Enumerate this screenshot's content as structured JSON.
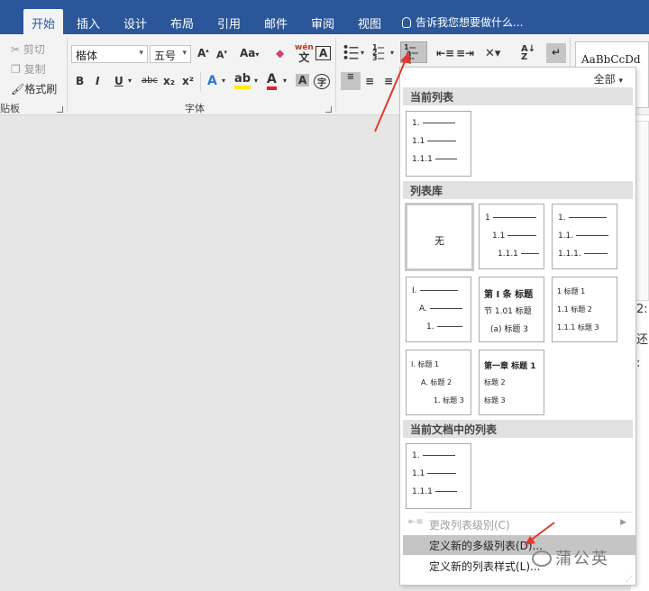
{
  "tabs": [
    "开始",
    "插入",
    "设计",
    "布局",
    "引用",
    "邮件",
    "审阅",
    "视图"
  ],
  "tell_me": "告诉我您想要做什么...",
  "clipboard": {
    "cut": "剪切",
    "copy": "复制",
    "format_painter": "格式刷",
    "group_label": "贴板"
  },
  "font": {
    "family": "楷体",
    "size": "五号",
    "group_label": "字体",
    "change_case": "Aa",
    "phonetic": "wén",
    "phonetic_char": "文",
    "bold": "B",
    "italic": "I",
    "underline": "U",
    "strikethrough": "abc",
    "subscript": "x₂",
    "superscript": "x²"
  },
  "styles_preview": "AaBbCcDd",
  "dropdown": {
    "filter": "全部",
    "current_list_header": "当前列表",
    "library_header": "列表库",
    "doc_lists_header": "当前文档中的列表",
    "none_label": "无",
    "cards": {
      "current": [
        "1.",
        "1.1",
        "1.1.1"
      ],
      "lib2": [
        "1",
        "1.1",
        "1.1.1"
      ],
      "lib3": [
        "1.",
        "1.1.",
        "1.1.1."
      ],
      "lib4": [
        "I.",
        "A.",
        "1."
      ],
      "lib5": [
        "第 I 条 标题",
        "节 1.01 标题",
        "(a) 标题 3"
      ],
      "lib6": [
        "1 标题 1",
        "1.1 标题 2",
        "1.1.1 标题 3"
      ],
      "lib7": [
        "I. 标题 1",
        "A. 标题 2",
        "1. 标题 3"
      ],
      "lib8": [
        "第一章 标题 1",
        "标题 2",
        "标题 3"
      ],
      "doc": [
        "1.",
        "1.1",
        "1.1.1"
      ]
    },
    "change_level": "更改列表级别(C)",
    "define_multilevel": "定义新的多级列表(D)...",
    "define_style": "定义新的列表样式(L)..."
  },
  "doc_side_text": [
    "2:",
    "还",
    ":"
  ],
  "watermark": "蒲公英",
  "colors": {
    "tab_bar": "#2b579a",
    "ribbon": "#f3f3f3",
    "highlight": "#c5c5c5",
    "arrow": "#e0392b"
  }
}
